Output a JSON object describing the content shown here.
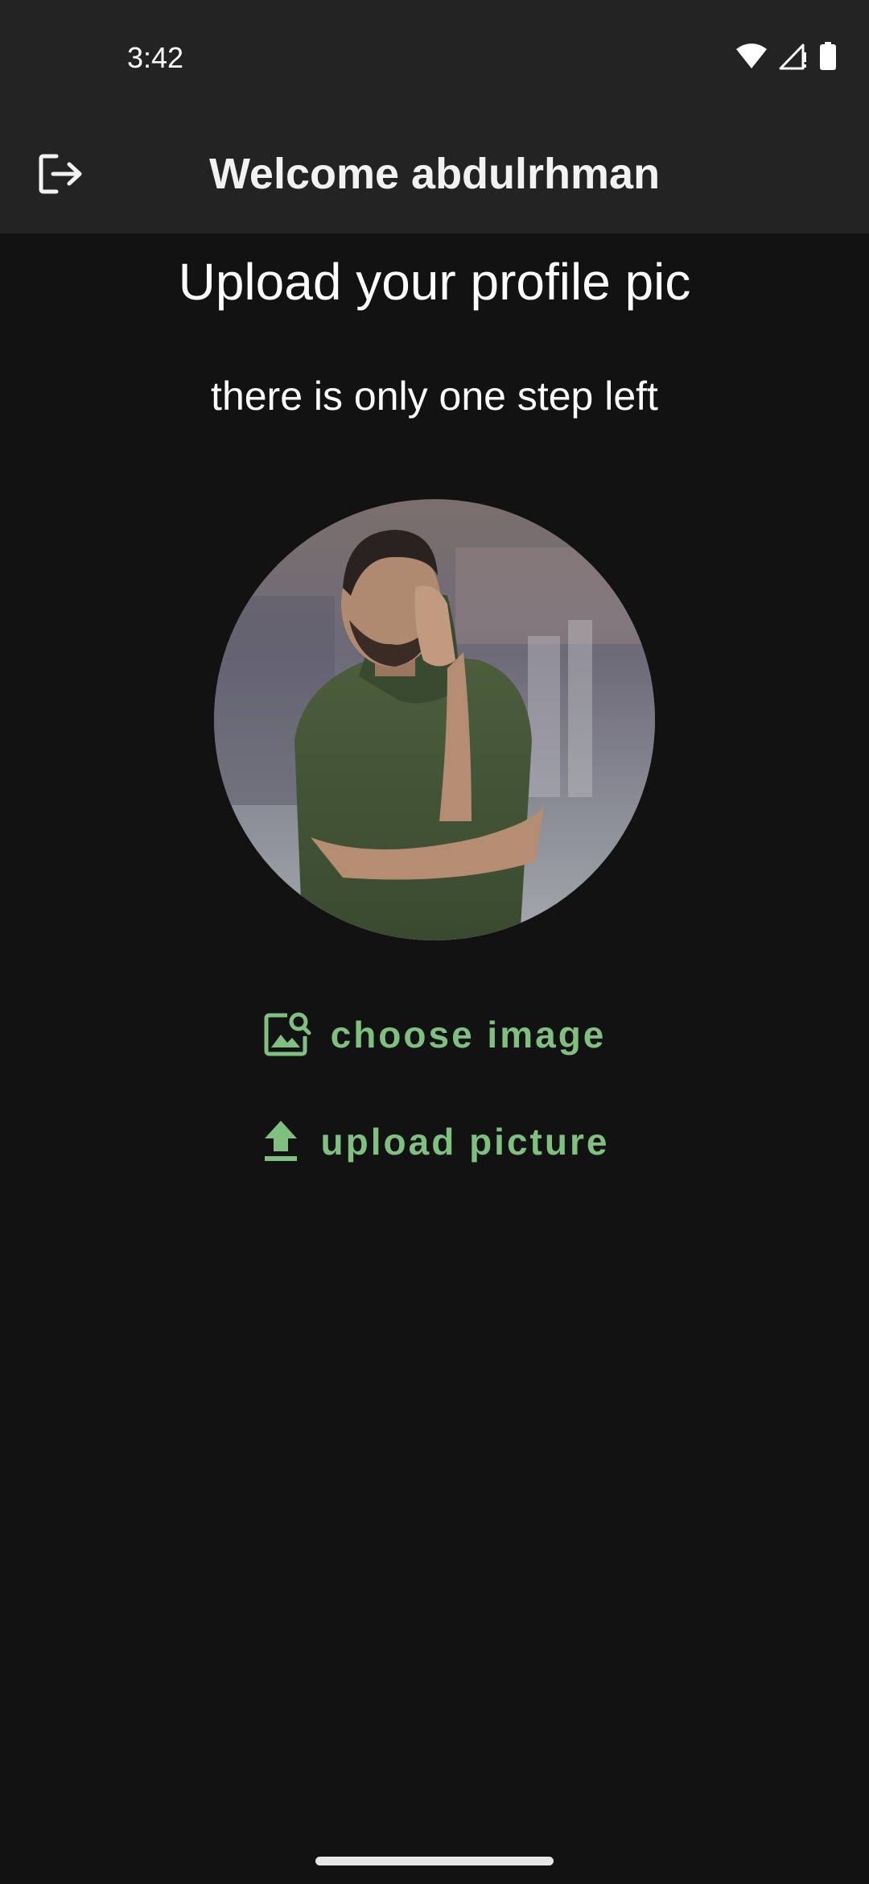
{
  "status_bar": {
    "time": "3:42",
    "icons": [
      "wifi-icon",
      "cellular-signal-icon",
      "battery-icon"
    ]
  },
  "app_bar": {
    "title": "Welcome abdulrhman",
    "leading_icon": "logout-icon"
  },
  "main": {
    "title": "Upload your profile pic",
    "subtitle": "there is only one step left",
    "avatar": "profile-photo",
    "actions": [
      {
        "label": "choose image",
        "icon": "image-search-icon"
      },
      {
        "label": "upload picture",
        "icon": "upload-icon"
      }
    ]
  },
  "colors": {
    "background": "#121212",
    "app_bar": "#232323",
    "accent": "#7fc080"
  }
}
